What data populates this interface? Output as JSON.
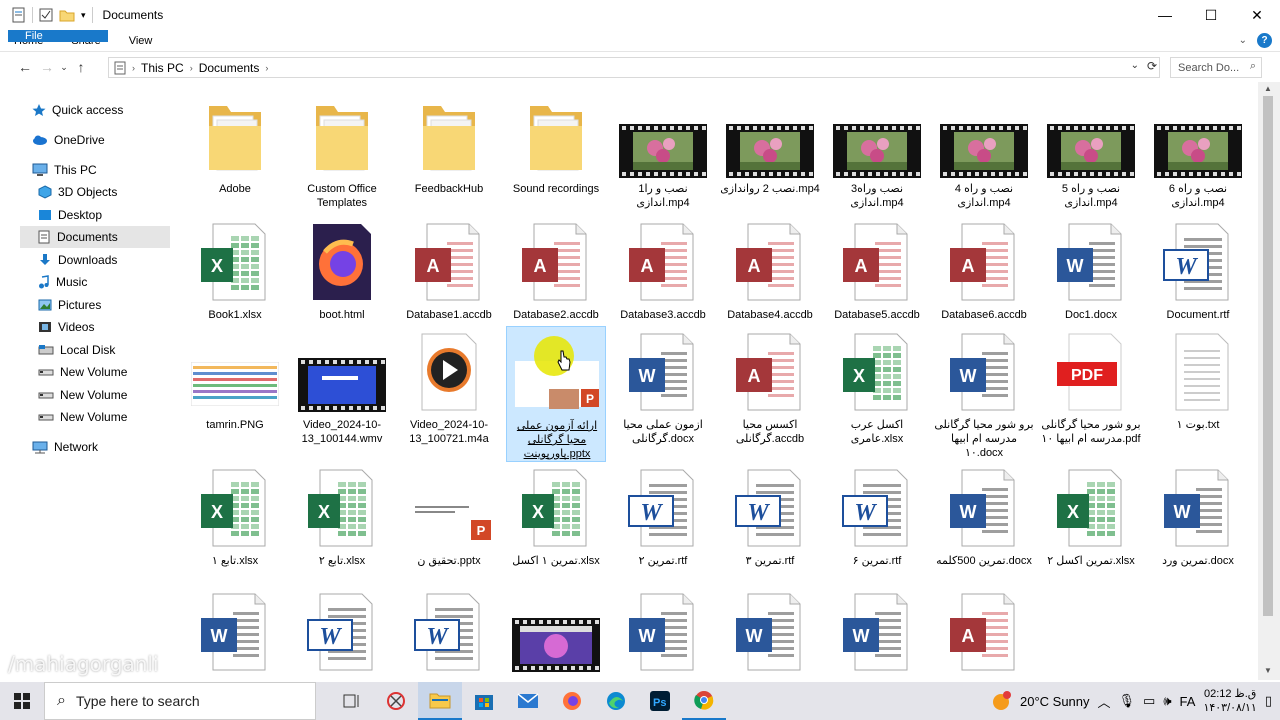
{
  "window": {
    "title": "Documents"
  },
  "ribbon": {
    "tabs": [
      "File",
      "Home",
      "Share",
      "View"
    ]
  },
  "address": {
    "crumbs": [
      "This PC",
      "Documents"
    ],
    "search_placeholder": "Search Do..."
  },
  "sidebar": {
    "items": [
      {
        "label": "Quick access",
        "icon": "star-icon"
      },
      {
        "label": "OneDrive",
        "icon": "cloud-icon"
      },
      {
        "label": "This PC",
        "icon": "pc-icon"
      },
      {
        "label": "3D Objects",
        "icon": "cube-icon"
      },
      {
        "label": "Desktop",
        "icon": "desktop-icon"
      },
      {
        "label": "Documents",
        "icon": "documents-icon"
      },
      {
        "label": "Downloads",
        "icon": "download-icon"
      },
      {
        "label": "Music",
        "icon": "music-icon"
      },
      {
        "label": "Pictures",
        "icon": "pictures-icon"
      },
      {
        "label": "Videos",
        "icon": "videos-icon"
      },
      {
        "label": "Local Disk",
        "icon": "disk-icon"
      },
      {
        "label": "New Volume",
        "icon": "drive-icon"
      },
      {
        "label": "New Volume",
        "icon": "drive-icon"
      },
      {
        "label": "New Volume",
        "icon": "drive-icon"
      },
      {
        "label": "Network",
        "icon": "network-icon"
      }
    ]
  },
  "files": [
    {
      "label": "Adobe",
      "type": "folder"
    },
    {
      "label": "Custom Office Templates",
      "type": "folder"
    },
    {
      "label": "FeedbackHub",
      "type": "folder"
    },
    {
      "label": "Sound recordings",
      "type": "folder"
    },
    {
      "label": "1نصب و را اندازی.mp4",
      "type": "video"
    },
    {
      "label": "نصب 2 رواندازی.mp4",
      "type": "video"
    },
    {
      "label": "3نصب وراه اندازی.mp4",
      "type": "video"
    },
    {
      "label": "نصب و راه 4 اندازی.mp4",
      "type": "video"
    },
    {
      "label": "نصب و راه 5 اندازی.mp4",
      "type": "video"
    },
    {
      "label": "نصب و راه 6 اندازی.mp4",
      "type": "video"
    },
    {
      "label": "Book1.xlsx",
      "type": "excel"
    },
    {
      "label": "boot.html",
      "type": "firefox"
    },
    {
      "label": "Database1.accdb",
      "type": "access"
    },
    {
      "label": "Database2.accdb",
      "type": "access"
    },
    {
      "label": "Database3.accdb",
      "type": "access"
    },
    {
      "label": "Database4.accdb",
      "type": "access"
    },
    {
      "label": "Database5.accdb",
      "type": "access"
    },
    {
      "label": "Database6.accdb",
      "type": "access"
    },
    {
      "label": "Doc1.docx",
      "type": "word"
    },
    {
      "label": "Document.rtf",
      "type": "wordpad"
    },
    {
      "label": "tamrin.PNG",
      "type": "image"
    },
    {
      "label": "Video_2024-10-13_100144.wmv",
      "type": "wmv"
    },
    {
      "label": "Video_2024-10-13_100721.m4a",
      "type": "media"
    },
    {
      "label": "ارائه آزمون عملی محیا گرگانلی پاورپوینت.pptx",
      "type": "pptx-sel"
    },
    {
      "label": "ازمون عملی محیا گرگانلی.docx",
      "type": "word"
    },
    {
      "label": "اکسس محیا گرگانلی.accdb",
      "type": "access"
    },
    {
      "label": "اکسل عرب عامری.xlsx",
      "type": "excel"
    },
    {
      "label": "برو شور محیا گرگانلی مدرسه ام ابیها ۱۰.docx",
      "type": "word"
    },
    {
      "label": "برو شور محیا گرگانلی مدرسه ام ابیها ۱۰.pdf",
      "type": "pdf"
    },
    {
      "label": "بوت ۱.txt",
      "type": "text"
    },
    {
      "label": "تابع ۱.xlsx",
      "type": "excel"
    },
    {
      "label": "تابع ۲.xlsx",
      "type": "excel"
    },
    {
      "label": "تحقیق ن.pptx",
      "type": "pptx"
    },
    {
      "label": "تمرین ۱ اکسل.xlsx",
      "type": "excel"
    },
    {
      "label": "تمرین ۲.rtf",
      "type": "wordpad"
    },
    {
      "label": "تمرین ۳.rtf",
      "type": "wordpad"
    },
    {
      "label": "تمرین ۶.rtf",
      "type": "wordpad"
    },
    {
      "label": "تمرین 500کلمه.docx",
      "type": "word"
    },
    {
      "label": "تمرین اکسل ۲.xlsx",
      "type": "excel"
    },
    {
      "label": "تمرین ورد.docx",
      "type": "word"
    },
    {
      "label": "",
      "type": "word"
    },
    {
      "label": "",
      "type": "wordpad"
    },
    {
      "label": "",
      "type": "wordpad"
    },
    {
      "label": "",
      "type": "wmv2"
    },
    {
      "label": "",
      "type": "word"
    },
    {
      "label": "",
      "type": "word"
    },
    {
      "label": "",
      "type": "word"
    },
    {
      "label": "",
      "type": "access"
    }
  ],
  "taskbar": {
    "search_placeholder": "Type here to search",
    "weather": "20°C  Sunny",
    "lang": "FA",
    "time": "ق.ظ 02:12",
    "date": "۱۴۰۳/۰۸/۱۱"
  },
  "watermark": "/mahiagorganli"
}
